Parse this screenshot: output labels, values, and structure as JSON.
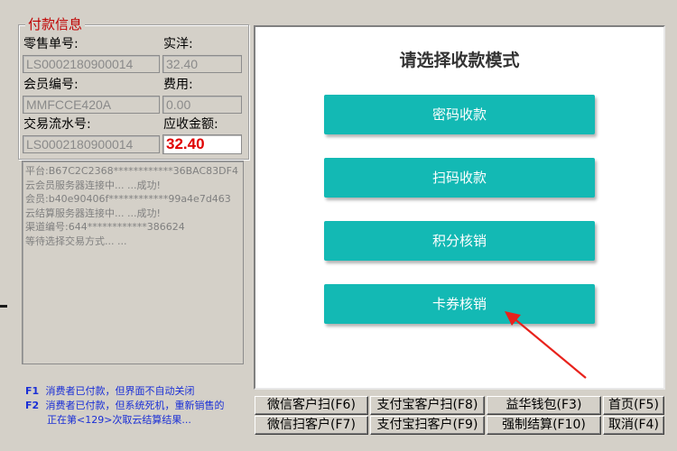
{
  "payment_info": {
    "legend": "付款信息",
    "retail_no_label": "零售单号:",
    "retail_no_value": "LS0002180900014",
    "actual_label": "实洋:",
    "actual_value": "32.40",
    "member_no_label": "会员编号:",
    "member_no_value": "MMFCCE420A",
    "fee_label": "费用:",
    "fee_value": "0.00",
    "serial_no_label": "交易流水号:",
    "serial_no_value": "LS0002180900014",
    "receivable_label": "应收金额:",
    "receivable_value": "32.40"
  },
  "log_lines": [
    "平台:B67C2C2368************36BAC83DF4",
    "云会员服务器连接中... ...成功!",
    "会员:b40e90406f************99a4e7d463",
    "云结算服务器连接中... ...成功!",
    "渠道编号:644************386624",
    "等待选择交易方式... ..."
  ],
  "hints": {
    "f1_key": "F1",
    "f1_text": "消费者已付款，但界面不自动关闭",
    "f2_key": "F2",
    "f2_text": "消费者已付款，但系统死机，重新销售的",
    "f2_cont": "正在第<129>次取云结算结果..."
  },
  "mode_panel": {
    "title": "请选择收款模式",
    "buttons": [
      "密码收款",
      "扫码收款",
      "积分核销",
      "卡券核销"
    ]
  },
  "bottom_buttons": {
    "row1": [
      "微信客户扫(F6)",
      "支付宝客户扫(F8)",
      "益华钱包(F3)",
      "首页(F5)"
    ],
    "row2": [
      "微信扫客户(F7)",
      "支付宝扫客户(F9)",
      "强制结算(F10)",
      "取消(F4)"
    ]
  },
  "colors": {
    "accent_teal": "#13b9b4",
    "arrow_red": "#e8221c",
    "amount_red": "#e00000"
  }
}
